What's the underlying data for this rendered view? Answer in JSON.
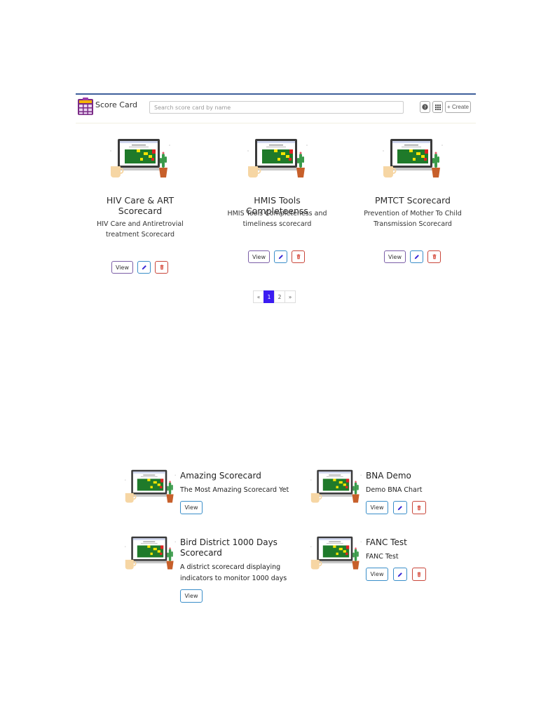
{
  "header": {
    "title": "Score Card",
    "search_placeholder": "Search score card by name",
    "help_icon": "question-circle-icon",
    "grid_icon": "grid-view-icon",
    "create_label": "+ Create"
  },
  "cards": [
    {
      "title_lines": [
        "HIV Care & ART",
        "Scorecard"
      ],
      "desc_lines": [
        "HIV Care and Antiretrovial",
        "treatment Scorecard"
      ],
      "view": "View"
    },
    {
      "title_lines": [
        "HMIS Tools Completeenss"
      ],
      "desc_lines": [
        "HMIS Tools Completeness and",
        "timeliness scorecard"
      ],
      "view": "View"
    },
    {
      "title_lines": [
        "PMTCT Scorecard"
      ],
      "desc_lines": [
        "Prevention of Mother To Child",
        "Transmission Scorecard"
      ],
      "view": "View"
    }
  ],
  "pagination": {
    "prev": "«",
    "pages": [
      "1",
      "2"
    ],
    "current": "1",
    "next": "»"
  },
  "list_cards": [
    {
      "title_lines": [
        "Amazing Scorecard"
      ],
      "desc_lines": [
        "The Most Amazing Scorecard Yet"
      ],
      "view": "View",
      "editable": false
    },
    {
      "title_lines": [
        "BNA Demo"
      ],
      "desc_lines": [
        "Demo BNA Chart"
      ],
      "view": "View",
      "editable": true
    },
    {
      "title_lines": [
        "Bird District 1000 Days",
        "Scorecard"
      ],
      "desc_lines": [
        "A district scorecard displaying",
        "indicators to monitor 1000 days"
      ],
      "view": "View",
      "editable": false
    },
    {
      "title_lines": [
        "FANC Test"
      ],
      "desc_lines": [
        "FANC Test"
      ],
      "view": "View",
      "editable": true
    }
  ],
  "colors": {
    "accent": "#3b1cf2",
    "header_border": "#3f5f9b",
    "view_border": "#7b5ea7",
    "edit_border": "#3a8ec9",
    "delete_border": "#c9463a"
  }
}
